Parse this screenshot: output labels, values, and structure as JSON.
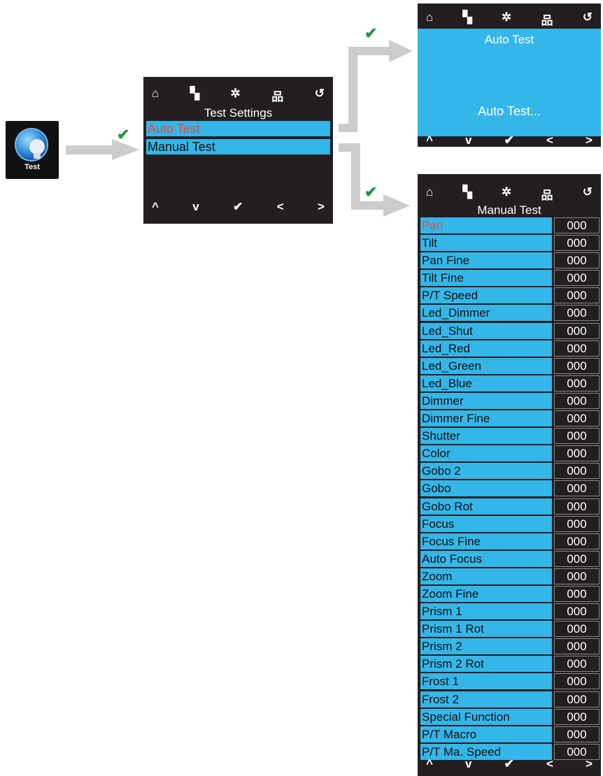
{
  "test_icon": {
    "label": "Test"
  },
  "icons_top": [
    "⌂",
    "▚",
    "✲",
    "品",
    "↺"
  ],
  "icons_bottom": [
    "^",
    "v",
    "✔",
    "<",
    ">"
  ],
  "screen_test_settings": {
    "title": "Test Settings",
    "items": [
      {
        "label": "Auto Test",
        "selected": true
      },
      {
        "label": "Manual Test",
        "selected": false
      }
    ]
  },
  "screen_auto_test": {
    "title": "Auto Test",
    "body": "Auto Test..."
  },
  "screen_manual_test": {
    "title": "Manual Test",
    "rows": [
      {
        "label": "Pan",
        "value": "000"
      },
      {
        "label": "Tilt",
        "value": "000"
      },
      {
        "label": "Pan Fine",
        "value": "000"
      },
      {
        "label": "Tilt Fine",
        "value": "000"
      },
      {
        "label": "P/T Speed",
        "value": "000"
      },
      {
        "label": "Led_Dimmer",
        "value": "000"
      },
      {
        "label": "Led_Shut",
        "value": "000"
      },
      {
        "label": "Led_Red",
        "value": "000"
      },
      {
        "label": "Led_Green",
        "value": "000"
      },
      {
        "label": "Led_Blue",
        "value": "000"
      },
      {
        "label": "Dimmer",
        "value": "000"
      },
      {
        "label": "Dimmer Fine",
        "value": "000"
      },
      {
        "label": "Shutter",
        "value": "000"
      },
      {
        "label": "Color",
        "value": "000"
      },
      {
        "label": "Gobo 2",
        "value": "000"
      },
      {
        "label": "Gobo",
        "value": "000"
      },
      {
        "label": "Gobo Rot",
        "value": "000"
      },
      {
        "label": "Focus",
        "value": "000"
      },
      {
        "label": "Focus Fine",
        "value": "000"
      },
      {
        "label": "Auto Focus",
        "value": "000"
      },
      {
        "label": "Zoom",
        "value": "000"
      },
      {
        "label": "Zoom Fine",
        "value": "000"
      },
      {
        "label": "Prism 1",
        "value": "000"
      },
      {
        "label": "Prism 1 Rot",
        "value": "000"
      },
      {
        "label": "Prism 2",
        "value": "000"
      },
      {
        "label": "Prism 2 Rot",
        "value": "000"
      },
      {
        "label": "Frost 1",
        "value": "000"
      },
      {
        "label": "Frost 2",
        "value": "000"
      },
      {
        "label": "Special Function",
        "value": "000"
      },
      {
        "label": "P/T Macro",
        "value": "000"
      },
      {
        "label": "P/T Ma. Speed",
        "value": "000"
      }
    ]
  },
  "colors": {
    "screen_bg": "#231f20",
    "highlight": "#35b6e9",
    "selected_text": "#e84a3a",
    "check": "#1e9a3c",
    "arrow": "#cccccc"
  }
}
